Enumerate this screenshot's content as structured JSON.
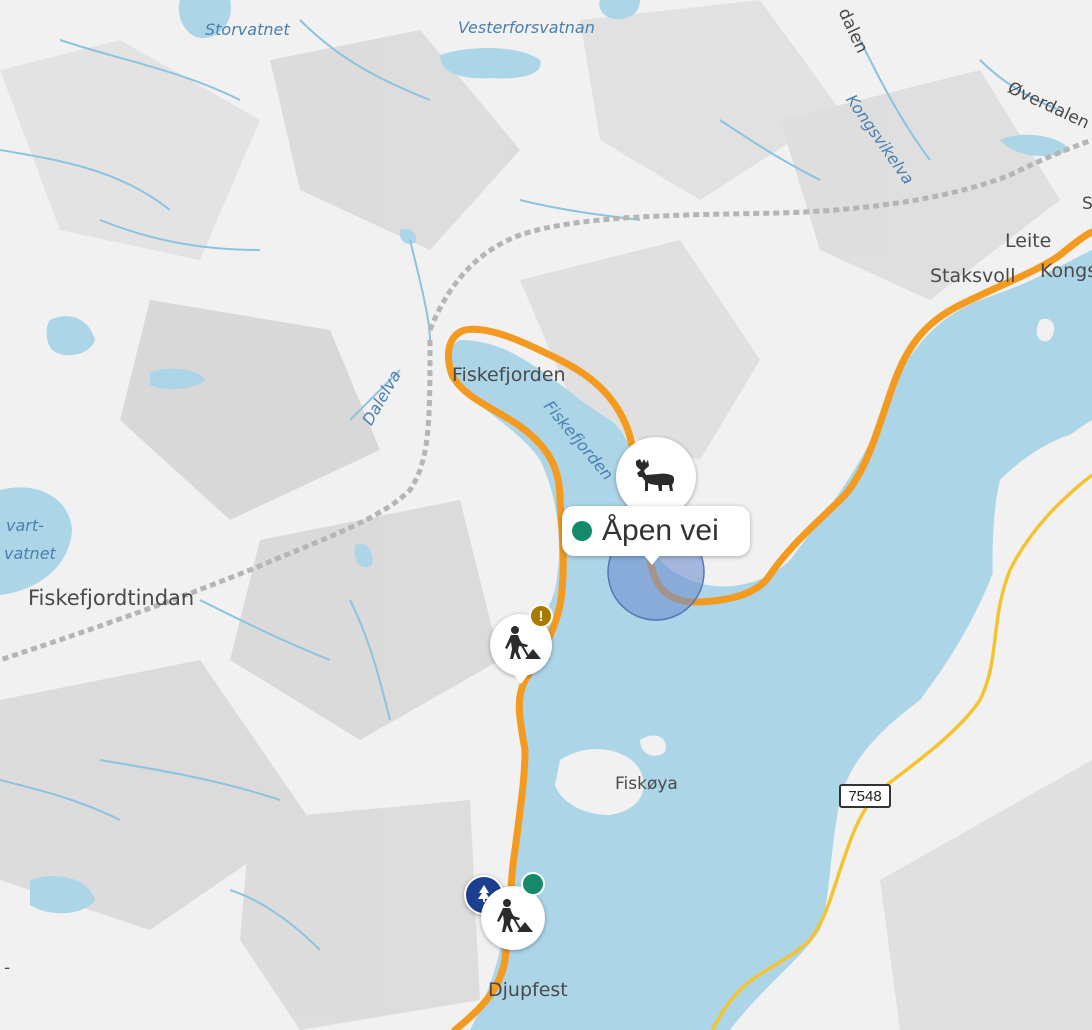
{
  "map": {
    "colors": {
      "land": "#f1f1f1",
      "water": "#acd5e8",
      "river": "#8ec3de",
      "road_main": "#f39a1f",
      "road_secondary": "#f4c430",
      "tunnel": "#b5b5b5",
      "open_status": "#138a6a",
      "warning": "#a97a00",
      "info_blue": "#1d3f8f"
    },
    "labels": {
      "storvatnet": "Storvatnet",
      "vesterforsvatnan": "Vesterforsvatnan",
      "kongsvikelva": "Kongsvikelva",
      "dalen": "dalen",
      "overdalen": "Øverdalen",
      "leite": "Leite",
      "kongs": "Kongs",
      "staksvoll": "Staksvoll",
      "fiskefjorden_place": "Fiskefjorden",
      "fiskefjorden_water": "Fiskefjorden",
      "dalelva": "Dalelva",
      "vart": "vart-",
      "vatnet": "vatnet",
      "fiskefjordtindan": "Fiskefjordtindan",
      "fiskoya": "Fiskøya",
      "djupfest": "Djupfest",
      "s_edge": "S",
      "dash_edge": "-"
    },
    "road_number": "7548",
    "popup": {
      "status_text": "Åpen vei"
    },
    "markers": {
      "moose": {
        "icon": "moose-icon"
      },
      "roadwork_1": {
        "icon": "roadwork-icon",
        "badge": "!"
      },
      "roadwork_2": {
        "icon": "roadwork-icon"
      },
      "info": {
        "icon": "tree-icon"
      }
    }
  }
}
